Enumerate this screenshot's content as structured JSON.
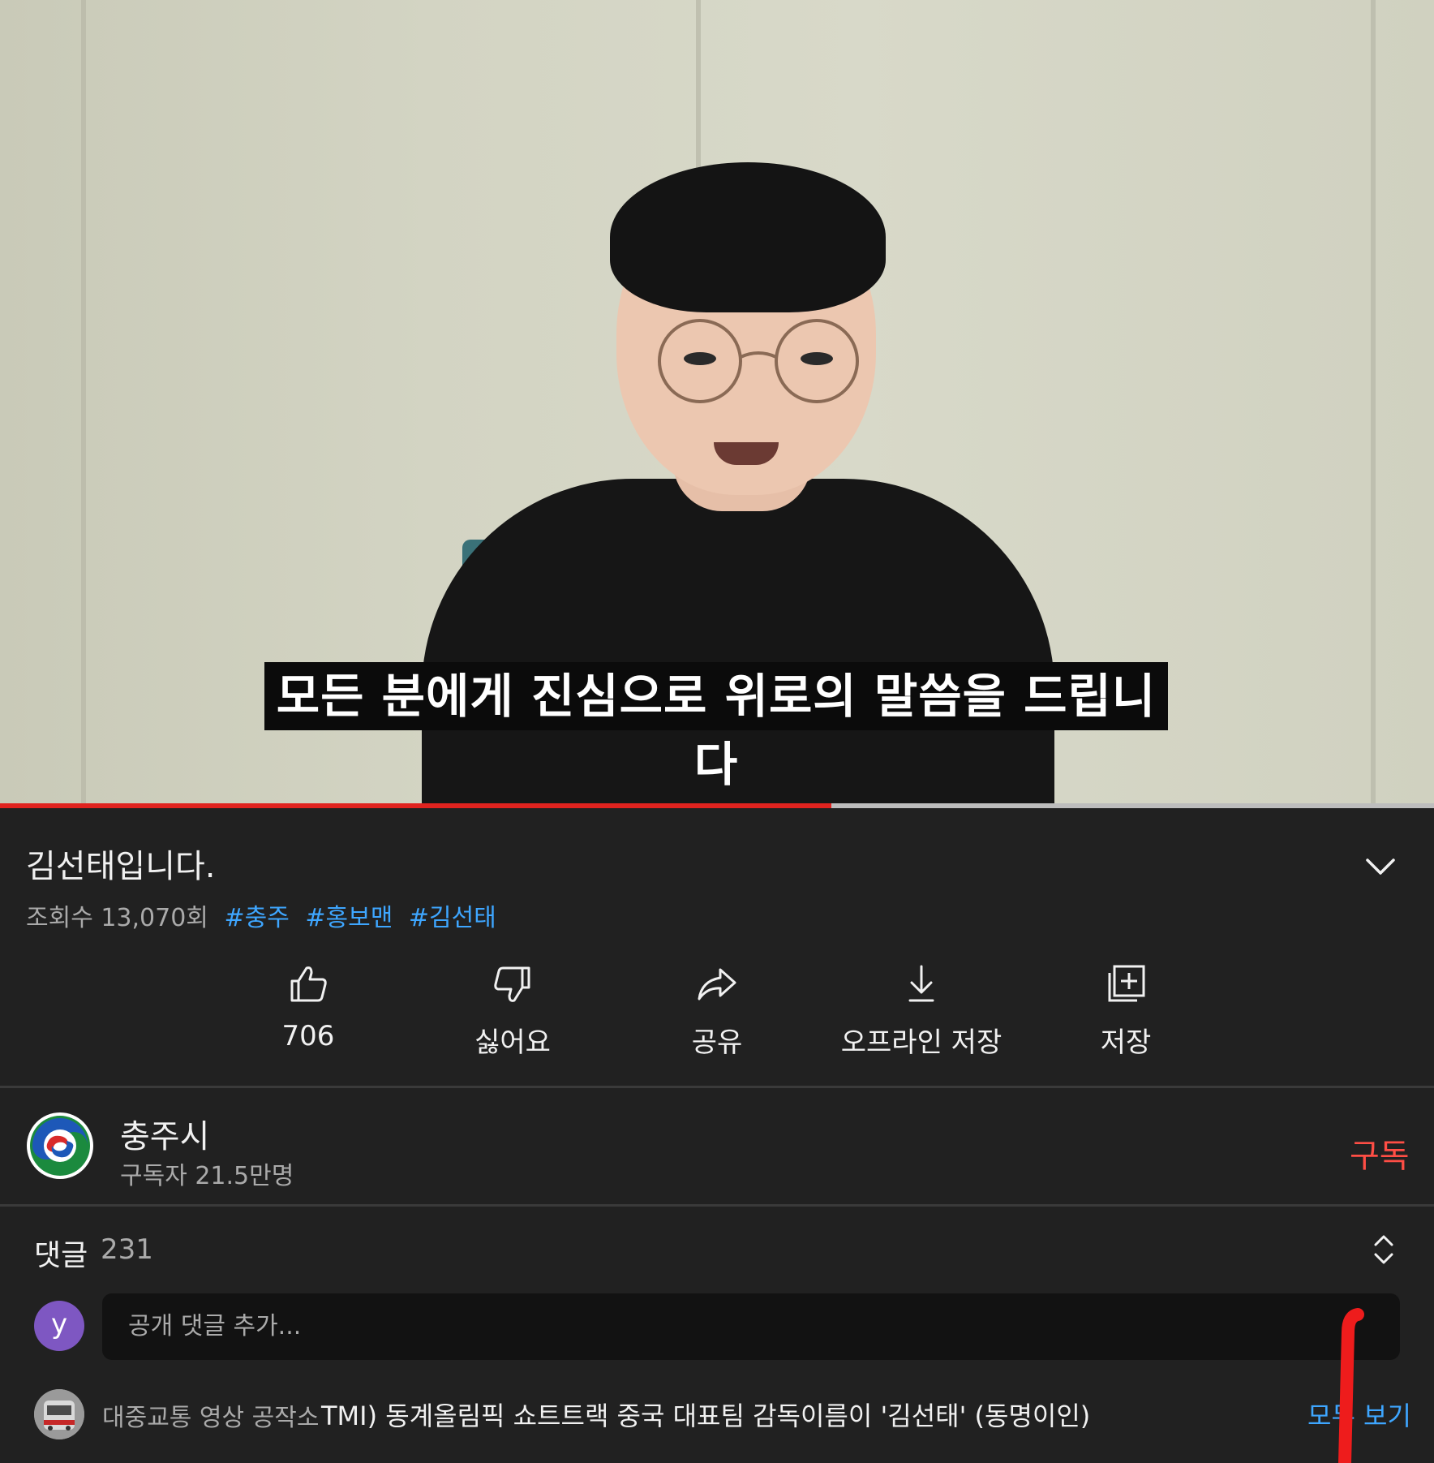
{
  "video": {
    "subtitle": "모든 분에게 진심으로 위로의 말씀을 드립니다",
    "progress_fraction": 0.58
  },
  "info": {
    "title": "김선태입니다.",
    "views": "조회수 13,070회",
    "hashtags": [
      "#충주",
      "#홍보맨",
      "#김선태"
    ]
  },
  "actions": {
    "like": "706",
    "dislike": "싫어요",
    "share": "공유",
    "download": "오프라인 저장",
    "save": "저장"
  },
  "channel": {
    "name": "충주시",
    "subscribers": "구독자 21.5만명",
    "subscribe": "구독"
  },
  "comments": {
    "label": "댓글",
    "count": "231",
    "user_initial": "y",
    "placeholder": "공개 댓글 추가...",
    "top_comment": {
      "author": "대중교통 영상 공작소",
      "text": "TMI) 동계올림픽 쇼트트랙 중국 대표팀 감독이름이 '김선태' (동명이인)"
    },
    "more": "모두 보기"
  },
  "colors": {
    "background": "#212121",
    "progress": "#e0231f",
    "link": "#3ea6ff",
    "subscribe": "#ff4e45",
    "avatar": "#7e57c2"
  },
  "icons": [
    "like-icon",
    "dislike-icon",
    "share-icon",
    "download-icon",
    "save-to-playlist-icon",
    "chevron-down-icon",
    "sort-icon"
  ]
}
